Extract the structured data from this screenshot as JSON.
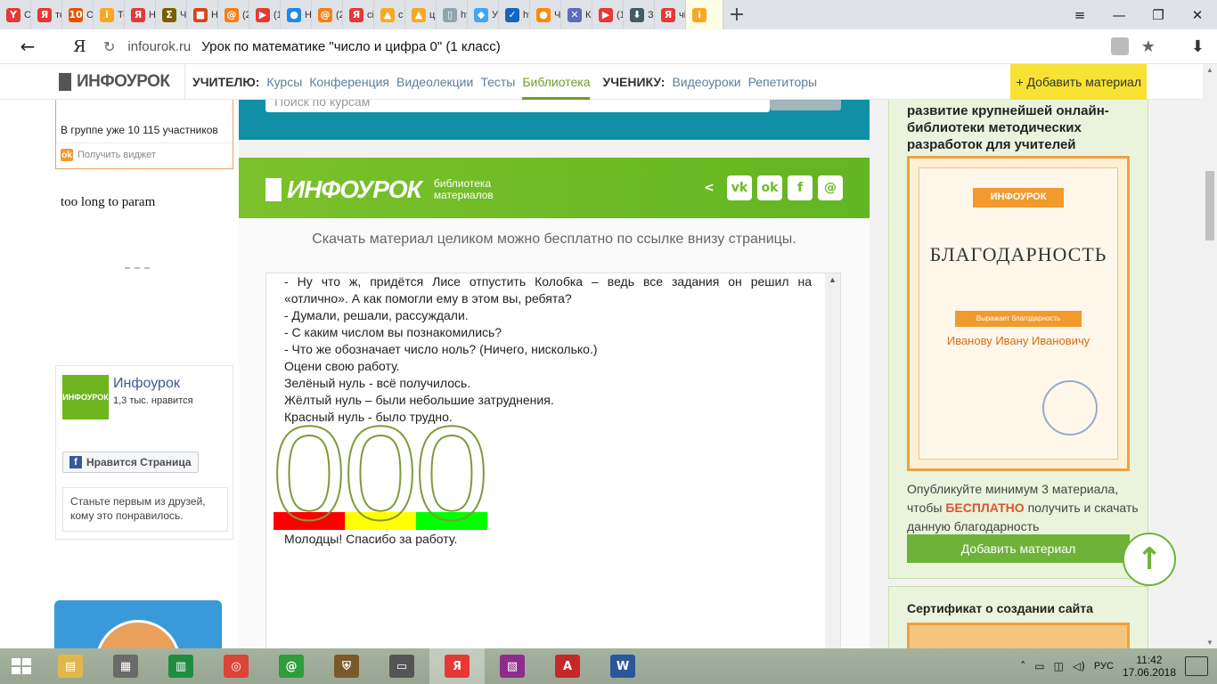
{
  "browser": {
    "tabs": [
      {
        "label": "Сі",
        "icon": "Y",
        "color": "#e53935"
      },
      {
        "label": "те",
        "icon": "Я",
        "color": "#e53935"
      },
      {
        "label": "О",
        "icon": "10",
        "color": "#e65100"
      },
      {
        "label": "Те",
        "icon": "i",
        "color": "#f9a825"
      },
      {
        "label": "Н",
        "icon": "Я",
        "color": "#e53935"
      },
      {
        "label": "Чі",
        "icon": "Σ",
        "color": "#7b5e00"
      },
      {
        "label": "Н",
        "icon": "■",
        "color": "#d84315"
      },
      {
        "label": "(2",
        "icon": "@",
        "color": "#f57f17"
      },
      {
        "label": "(1",
        "icon": "▶",
        "color": "#e53935"
      },
      {
        "label": "Н",
        "icon": "●",
        "color": "#1e88e5"
      },
      {
        "label": "(2",
        "icon": "@",
        "color": "#f57f17"
      },
      {
        "label": "сі",
        "icon": "Я",
        "color": "#e53935"
      },
      {
        "label": "с",
        "icon": "▲",
        "color": "#f9a825"
      },
      {
        "label": "ці",
        "icon": "▲",
        "color": "#f9a825"
      },
      {
        "label": "ht",
        "icon": "▯",
        "color": "#90a4ae"
      },
      {
        "label": "У",
        "icon": "◆",
        "color": "#42a5f5"
      },
      {
        "label": "ht",
        "icon": "✓",
        "color": "#1565c0"
      },
      {
        "label": "Ч",
        "icon": "●",
        "color": "#fb8c00"
      },
      {
        "label": "Кі",
        "icon": "✕",
        "color": "#5c6bc0"
      },
      {
        "label": "(1",
        "icon": "▶",
        "color": "#e53935"
      },
      {
        "label": "За",
        "icon": "⬇",
        "color": "#455a64"
      },
      {
        "label": "чі",
        "icon": "Я",
        "color": "#e53935"
      },
      {
        "label": "",
        "icon": "i",
        "color": "#f9a825"
      }
    ],
    "back_icon": "←",
    "yandex_logo": "Я",
    "reload_icon": "↻",
    "host": "infourok.ru",
    "page_title": "Урок по математике \"число и цифра 0\" (1 класс)",
    "star_icon": "★",
    "download_icon": "⬇"
  },
  "sitenav": {
    "logo": "ИНФОУРОК",
    "teacher_label": "УЧИТЕЛЮ:",
    "teacher_links": [
      "Курсы",
      "Конференция",
      "Видеолекции",
      "Тесты",
      "Библиотека"
    ],
    "student_label": "УЧЕНИКУ:",
    "student_links": [
      "Видеоуроки",
      "Репетиторы"
    ],
    "add_material": "+ Добавить материал"
  },
  "left": {
    "ok_group_count": "В группе уже 10 115 участников",
    "ok_get_widget": "Получить виджет",
    "too_long": "too long to param",
    "fb_page_name": "Инфоурок",
    "fb_likes": "1,3 тыс. нравится",
    "fb_like_button": "Нравится Страница",
    "fb_first_friends": "Станьте первым из друзей, кому это понравилось."
  },
  "center": {
    "search_placeholder": "Поиск по курсам",
    "banner_logo": "ИНФОУРОК",
    "banner_sub1": "библиотека",
    "banner_sub2": "материалов",
    "download_note": "Скачать материал целиком можно бесплатно по ссылке внизу страницы.",
    "doc_lines": [
      "- Ну что ж, придётся Лисе отпустить Колобка – ведь все задания он решил на",
      "«отлично». А как помогли ему в этом вы, ребята?",
      "- Думали, решали, рассуждали.",
      "- С каким числом вы познакомились?",
      "- Что же обозначает число ноль? (Ничего, нисколько.)",
      "Оцени свою работу.",
      "Зелёный нуль - всё получилось.",
      "Жёлтый нуль – были небольшие затруднения.",
      "Красный нуль - было трудно."
    ],
    "zero_glyph": "0",
    "zero_colors": [
      "#ff0000",
      "#ffff00",
      "#00ff00"
    ],
    "thanks": "Молодцы! Спасибо за работу."
  },
  "right": {
    "title": "развитие крупнейшей онлайн-библиотеки методических разработок для учителей",
    "cert_logo": "ИНФОУРОК",
    "cert_heading": "БЛАГОДАРНОСТЬ",
    "cert_ribbon": "Выражает благодарность",
    "cert_name": "Иванову Ивану Ивановичу",
    "publish_pre": "Опубликуйте минимум 3 материала, чтобы ",
    "publish_free": "БЕСПЛАТНО",
    "publish_post": " получить и скачать данную благодарность",
    "add_button": "Добавить материал",
    "up_icon": "↑",
    "cert2_title": "Сертификат о создании сайта"
  },
  "taskbar": {
    "apps": [
      {
        "name": "explorer",
        "icon": "▤",
        "color": "#e0b84a"
      },
      {
        "name": "mosaic",
        "icon": "▦",
        "color": "#6a6a6a"
      },
      {
        "name": "excel",
        "icon": "▥",
        "color": "#1e8e3e"
      },
      {
        "name": "chrome",
        "icon": "◎",
        "color": "#db4437"
      },
      {
        "name": "mail",
        "icon": "@",
        "color": "#2e9d3a"
      },
      {
        "name": "shield",
        "icon": "⛨",
        "color": "#7a5a2a"
      },
      {
        "name": "scanner",
        "icon": "▭",
        "color": "#555"
      },
      {
        "name": "yandex",
        "icon": "Я",
        "color": "#e53935"
      },
      {
        "name": "winrar",
        "icon": "▧",
        "color": "#8e2c8e"
      },
      {
        "name": "pdf",
        "icon": "A",
        "color": "#c62828"
      },
      {
        "name": "word",
        "icon": "W",
        "color": "#2b579a"
      }
    ],
    "lang": "РУС",
    "time": "11:42",
    "date": "17.06.2018"
  }
}
